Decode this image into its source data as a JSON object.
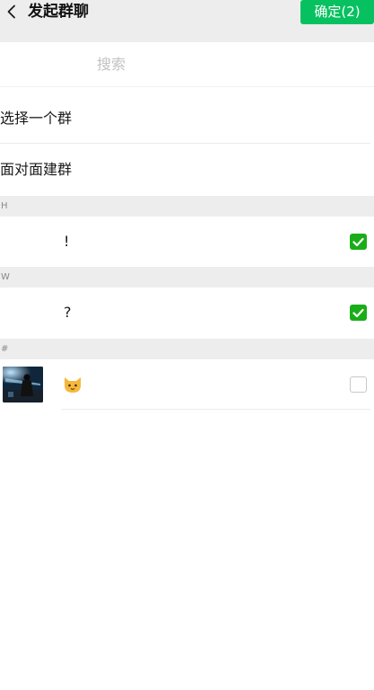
{
  "header": {
    "title": "发起群聊",
    "confirm_label": "确定(2)"
  },
  "search": {
    "placeholder": "搜索"
  },
  "menu": {
    "select_group": "选择一个群",
    "face_to_face": "面对面建群"
  },
  "sections": [
    "H",
    "W",
    "#"
  ],
  "contacts": [
    {
      "name": "!",
      "checked": true
    },
    {
      "name": "?",
      "checked": true
    },
    {
      "name": "",
      "avatar": "cat-emoji-icon",
      "checked": false
    }
  ],
  "colors": {
    "confirm_green": "#07c160",
    "check_green": "#1aad19",
    "section_bg": "#ededed"
  },
  "icons": {
    "back": "chevron-left-icon",
    "checked": "checkmark-icon",
    "contact_3_name": "cat-face-emoji"
  }
}
